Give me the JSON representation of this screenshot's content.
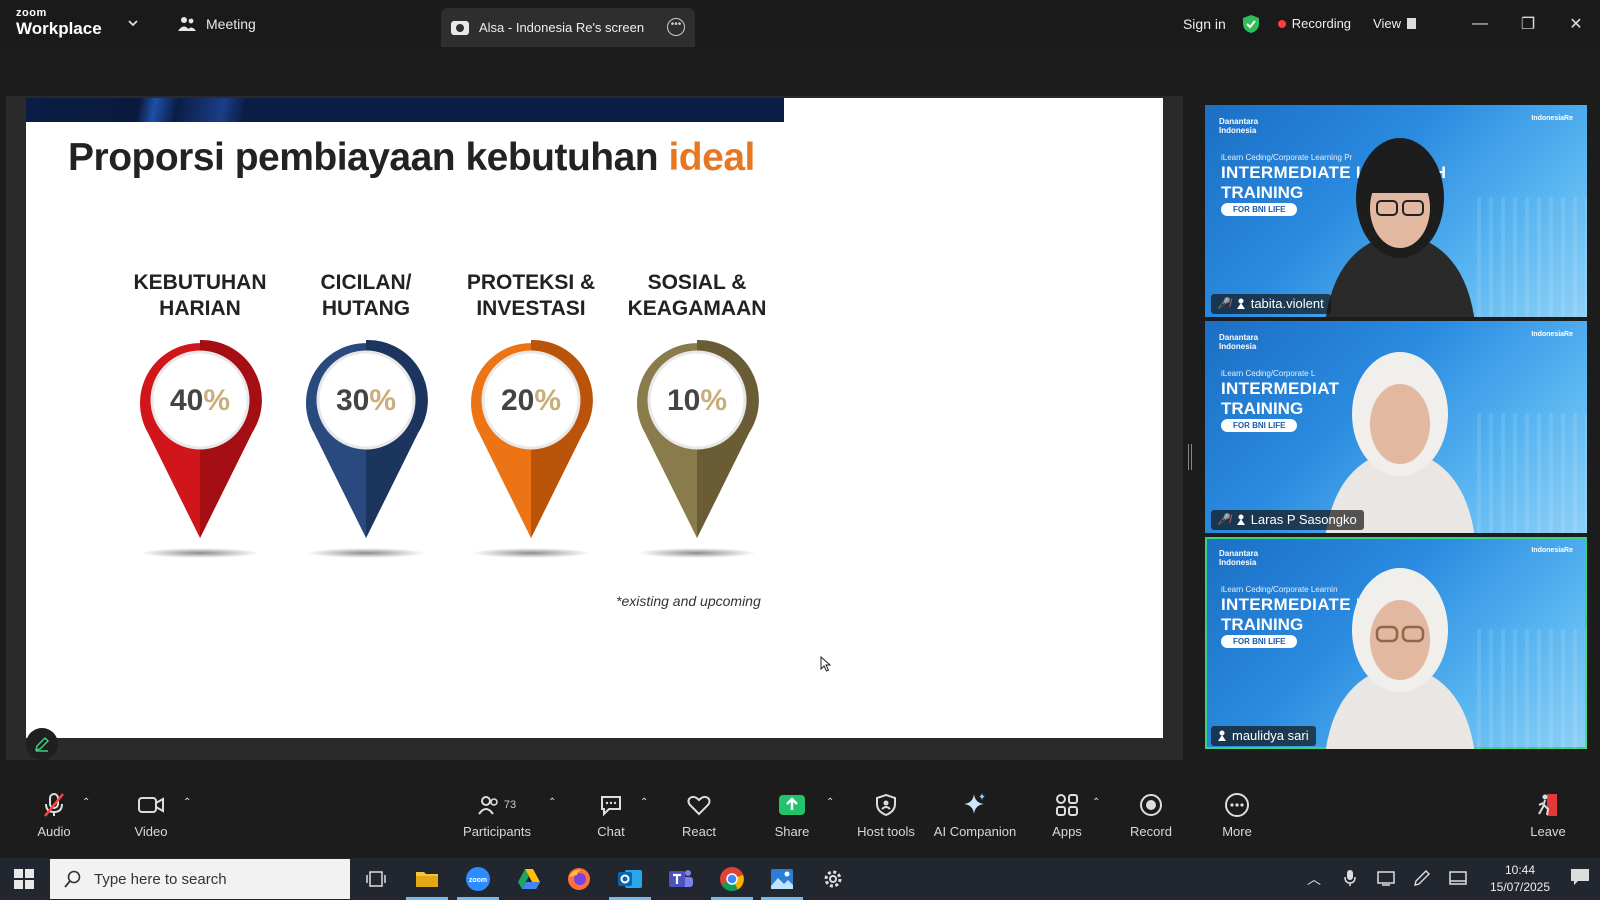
{
  "titlebar": {
    "logo_small": "zoom",
    "logo_big": "Workplace",
    "meeting_tab": "Meeting",
    "share_tab": "Alsa - Indonesia Re's screen",
    "signin": "Sign in",
    "recording": "Recording",
    "view": "View"
  },
  "slide": {
    "title_main": "Proporsi pembiayaan kebutuhan ",
    "title_accent": "ideal",
    "pins": [
      {
        "label": "KEBUTUHAN\nHARIAN",
        "value": "40",
        "color": "#d0161b",
        "dark": "#a50f13"
      },
      {
        "label": "CICILAN/\nHUTANG",
        "value": "30",
        "color": "#2a4a7f",
        "dark": "#1c355f"
      },
      {
        "label": "PROTEKSI &\nINVESTASI",
        "value": "20",
        "color": "#ec7414",
        "dark": "#b9540a"
      },
      {
        "label": "SOSIAL &\nKEAGAMAAN",
        "value": "10",
        "color": "#8a7b4c",
        "dark": "#6a5d36"
      }
    ],
    "percent_sign": "%",
    "footnote": "*existing and upcoming"
  },
  "tiles": [
    {
      "brand": "Danantara\nIndonesia",
      "brand2": "IndonesiaRe",
      "sub": "iLearn Ceding/Corporate Learning Pr",
      "line1": "INTERMEDIATE LI      ALTH",
      "line2": "TRAINING",
      "pill": "FOR BNI LIFE",
      "name": "tabita.violent",
      "muted": true
    },
    {
      "brand": "Danantara\nIndonesia",
      "brand2": "IndonesiaRe",
      "sub": "iLearn Ceding/Corporate L",
      "line1": "INTERMEDIAT        EALTH",
      "line2": "TRAINING",
      "pill": "FOR BNI LIFE",
      "name": "Laras P Sasongko",
      "muted": true
    },
    {
      "brand": "Danantara\nIndonesia",
      "brand2": "IndonesiaRe",
      "sub": "iLearn Ceding/Corporate Learnin",
      "line1": "INTERMEDIATE L       TH",
      "line2": "TRAINING",
      "pill": "FOR BNI LIFE",
      "name": "maulidya sari",
      "muted": false
    }
  ],
  "controls": {
    "audio": "Audio",
    "video": "Video",
    "participants": "Participants",
    "participants_count": "73",
    "chat": "Chat",
    "react": "React",
    "share": "Share",
    "host_tools": "Host tools",
    "ai_companion": "AI Companion",
    "apps": "Apps",
    "record": "Record",
    "more": "More",
    "leave": "Leave"
  },
  "taskbar": {
    "search_placeholder": "Type here to search",
    "time": "10:44",
    "date": "15/07/2025"
  },
  "colors": {
    "accent_orange": "#e87722",
    "active_speaker": "#3ad27a",
    "recording_dot": "#ff3b3b",
    "share_green": "#23c36b"
  }
}
